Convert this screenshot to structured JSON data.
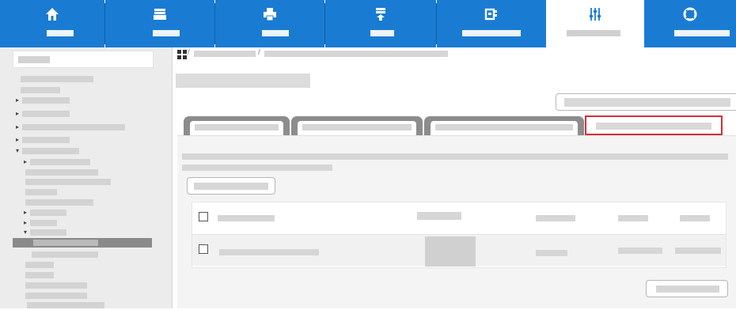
{
  "toolbar": {
    "active_index": 5,
    "buttons": [
      {
        "icon": "home-icon"
      },
      {
        "icon": "tray-icon"
      },
      {
        "icon": "printer-icon"
      },
      {
        "icon": "download-icon"
      },
      {
        "icon": "machine-icon"
      },
      {
        "icon": "sliders-icon"
      },
      {
        "icon": "lifebuoy-icon"
      }
    ]
  },
  "breadcrumb": {
    "icon": "sitemap-icon",
    "separator": "/"
  },
  "table": {
    "rows": [
      {
        "checked": false
      },
      {
        "checked": false
      }
    ]
  },
  "colors": {
    "toolbar_blue": "#1a7bd3",
    "active_tab_outline": "#d32f3b",
    "sidebar_bg": "#ececec",
    "panel_bg": "#f4f4f4"
  }
}
